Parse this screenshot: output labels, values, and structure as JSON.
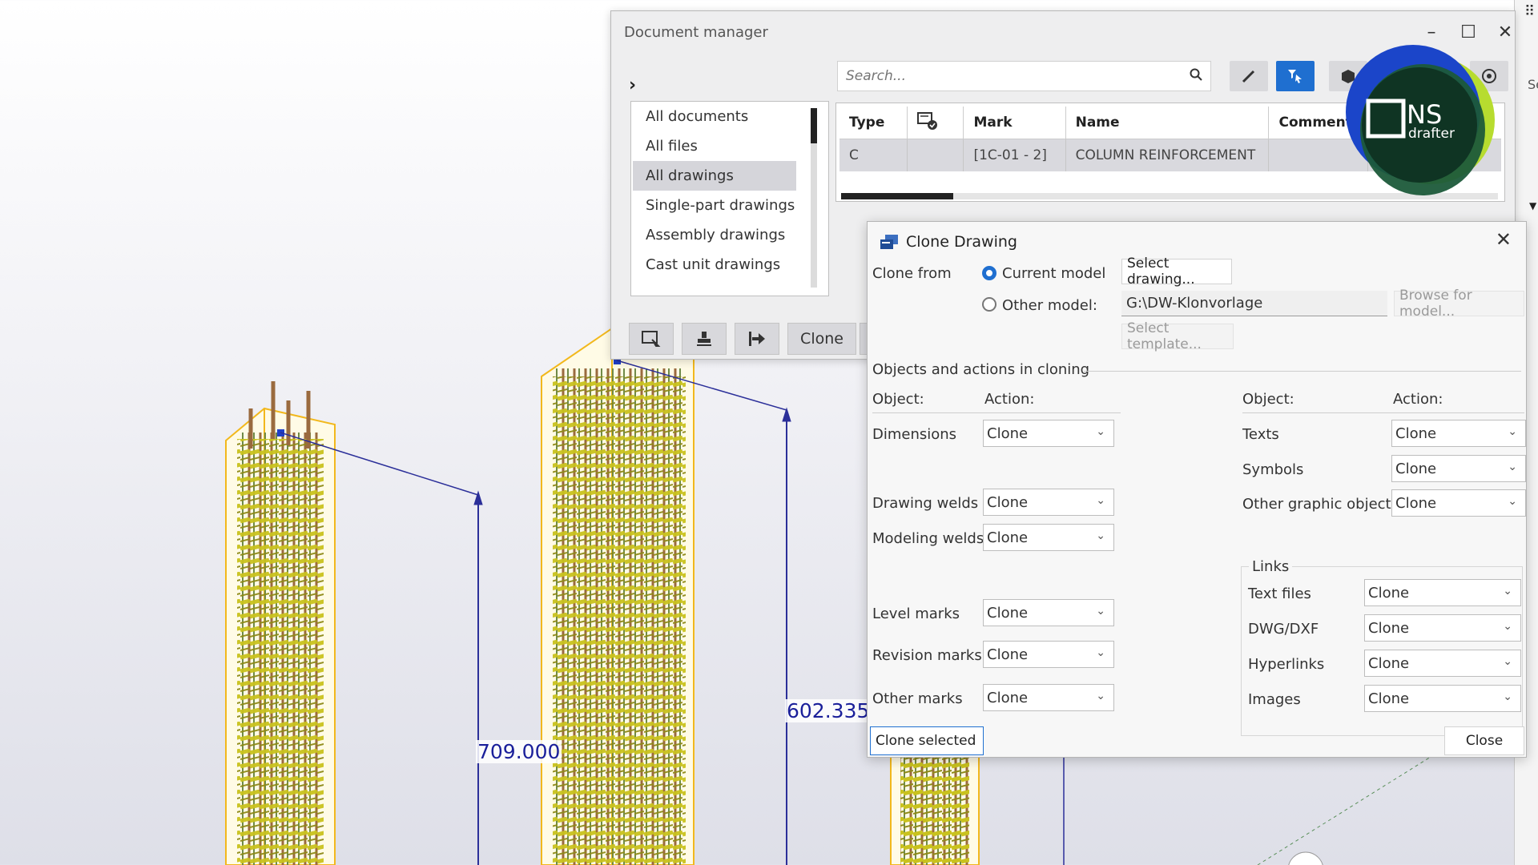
{
  "viewport": {
    "dimension_a": "709.000",
    "dimension_b": "602.335",
    "right_edge_fragment": "Se"
  },
  "document_manager": {
    "title": "Document manager",
    "search_placeholder": "Search...",
    "nav_items": [
      {
        "label": "All documents",
        "active": false
      },
      {
        "label": "All files",
        "active": false
      },
      {
        "label": "All drawings",
        "active": true
      },
      {
        "label": "Single-part drawings",
        "active": false
      },
      {
        "label": "Assembly drawings",
        "active": false
      },
      {
        "label": "Cast unit drawings",
        "active": false
      }
    ],
    "table": {
      "columns": [
        "Type",
        "",
        "Mark",
        "Name",
        "Comment"
      ],
      "rows": [
        {
          "type": "C",
          "status": "",
          "mark": "[1C-01 - 2]",
          "name": "COLUMN REINFORCEMENT",
          "comment": ""
        }
      ]
    },
    "bottom_buttons": {
      "clone": "Clone"
    }
  },
  "logo": {
    "text_main": "NS",
    "text_sub": "drafter"
  },
  "clone_dialog": {
    "title": "Clone Drawing",
    "clone_from_label": "Clone from",
    "current_model_label": "Current model",
    "other_model_label": "Other model:",
    "select_drawing_button": "Select drawing...",
    "model_path": "G:\\DW-Klonvorlage",
    "browse_button": "Browse for model...",
    "select_template_button": "Select template...",
    "section_title": "Objects and actions in cloning",
    "object_header": "Object:",
    "action_header": "Action:",
    "left_objects": [
      {
        "label": "Dimensions",
        "action": "Clone"
      },
      {
        "label": "Drawing welds",
        "action": "Clone"
      },
      {
        "label": "Modeling welds",
        "action": "Clone"
      },
      {
        "label": "Level marks",
        "action": "Clone"
      },
      {
        "label": "Revision marks",
        "action": "Clone"
      },
      {
        "label": "Other marks",
        "action": "Clone"
      }
    ],
    "right_objects": [
      {
        "label": "Texts",
        "action": "Clone"
      },
      {
        "label": "Symbols",
        "action": "Clone"
      },
      {
        "label": "Other graphic objects",
        "action": "Clone"
      }
    ],
    "links_title": "Links",
    "links": [
      {
        "label": "Text files",
        "action": "Clone"
      },
      {
        "label": "DWG/DXF",
        "action": "Clone"
      },
      {
        "label": "Hyperlinks",
        "action": "Clone"
      },
      {
        "label": "Images",
        "action": "Clone"
      }
    ],
    "clone_selected_button": "Clone selected",
    "close_button": "Close"
  },
  "colors": {
    "accent": "#1f6fd0",
    "dimension": "#1a1f9a",
    "rebar_yellow": "#c9c21e",
    "rebar_brown": "#9a6a3e",
    "outline_orange": "#f2b81c"
  },
  "icons": [
    "search-icon",
    "pencil-icon",
    "filter-cursor-icon",
    "cube-icon",
    "target-icon",
    "minimize-icon",
    "maximize-icon",
    "close-icon",
    "chevron-right-icon",
    "clone-drawing-icon",
    "chevron-down-icon"
  ]
}
